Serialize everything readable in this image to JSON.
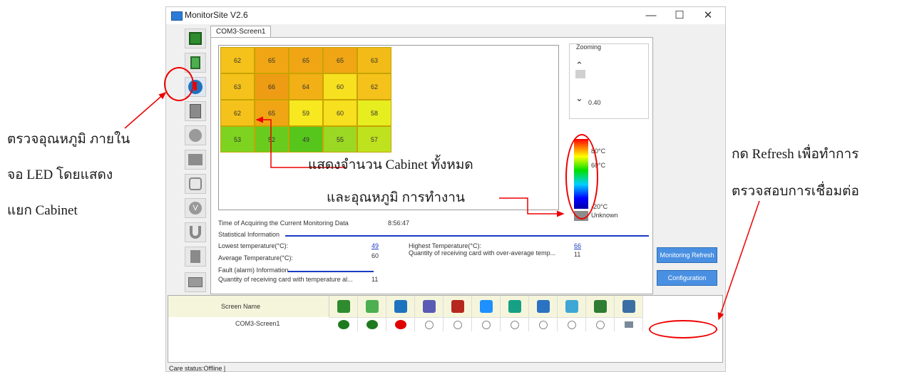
{
  "annotations": {
    "left_line1": "ตรวจอุณหภูมิ ภายใน",
    "left_line2": "จอ LED โดยแสดง",
    "left_line3": "แยก Cabinet",
    "center_line1": "แสดงจำนวน Cabinet ทั้งหมด",
    "center_line2": "และอุณหภูมิ การทำงาน",
    "right_line1": "กด Refresh เพื่อทำการ",
    "right_line2": "ตรวจสอบการเชื่อมต่อ"
  },
  "window": {
    "title": "MonitorSite V2.6",
    "minimize": "—",
    "maximize": "☐",
    "close": "✕"
  },
  "left_toolbar": {
    "icons": [
      "receiving-card-icon",
      "monitoring-card-icon",
      "temperature-icon",
      "cabinet-door-icon",
      "humidity-icon",
      "smoke-icon",
      "fan-icon",
      "voltage-icon",
      "magnet-icon",
      "exit-icon",
      "module-icon"
    ]
  },
  "tab": {
    "label": "COM3-Screen1"
  },
  "temperature_grid": {
    "rows": [
      [
        "62",
        "65",
        "65",
        "65",
        "63"
      ],
      [
        "63",
        "66",
        "64",
        "60",
        "62"
      ],
      [
        "62",
        "65",
        "59",
        "60",
        "58"
      ],
      [
        "53",
        "52",
        "49",
        "55",
        "57"
      ]
    ],
    "colors": [
      [
        "#f4c21a",
        "#f0a614",
        "#f0a614",
        "#f0a614",
        "#f3bb18"
      ],
      [
        "#f4c21a",
        "#ee9c13",
        "#f2b016",
        "#f7e01f",
        "#f4c21a"
      ],
      [
        "#f4c21a",
        "#f0a614",
        "#f7e81f",
        "#f7e01f",
        "#e6ee1f"
      ],
      [
        "#7ed321",
        "#6acb1f",
        "#56c61d",
        "#9bd823",
        "#bfe21f"
      ]
    ]
  },
  "zooming": {
    "label": "Zooming",
    "up": "⌃",
    "down": "⌄",
    "value": "0.40"
  },
  "legend": {
    "high": "80°C",
    "mid": "60°C",
    "low": "-20°C",
    "unknown": "Unknown"
  },
  "monitoring": {
    "time_label": "Time of Acquiring the Current Monitoring Data",
    "time_value": "8:56:47",
    "stat_header": "Statistical Information",
    "lowest_label": "Lowest temperature(°C):",
    "lowest_value": "49",
    "average_label": "Average Temperature(°C):",
    "average_value": "60",
    "highest_label": "Highest Temperature(°C):",
    "highest_value": "66",
    "over_avg_label": "Quantity of receiving card with over-average temp...",
    "over_avg_value": "11",
    "fault_header": "Fault (alarm) Information",
    "fault_label": "Quantity of receiving card with temperature al...",
    "fault_value": "11"
  },
  "buttons": {
    "refresh": "Monitoring Refresh",
    "configuration": "Configuration"
  },
  "status_table": {
    "header": "Screen Name",
    "column_icons": [
      "receiving-card-icon",
      "monitoring-card-icon",
      "temperature-icon",
      "cabinet-door-icon",
      "smoke-icon",
      "fan-icon",
      "voltage-icon",
      "magnet-icon",
      "exit-icon",
      "module-icon",
      "globe-icon"
    ],
    "row_name": "COM3-Screen1",
    "statuses": [
      "ok",
      "ok",
      "alarm",
      "none",
      "none",
      "none",
      "none",
      "none",
      "none",
      "none",
      "monitor"
    ],
    "status_colors": {
      "ok": "#1e7a1e",
      "alarm": "#e00000"
    }
  },
  "status_bar": "Care status:Offline  |"
}
